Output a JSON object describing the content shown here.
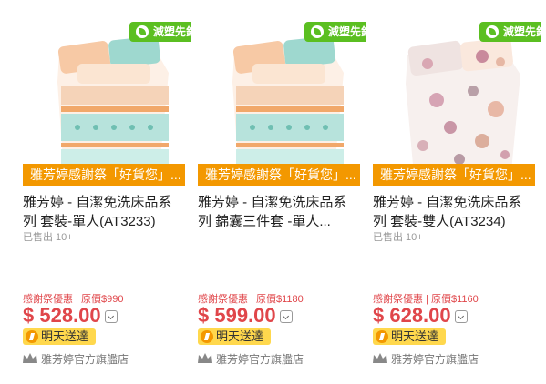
{
  "products": [
    {
      "eco_badge": "減塑先鋒",
      "promo": "雅芳婷感謝祭「好貨您」...",
      "title": "雅芳婷 - 自潔免洗床品系列 套裝-單人(AT3233)",
      "sold": "已售出 10+",
      "price_note": "感謝祭優惠 | 原價$990",
      "price": "$ 528.00",
      "delivery": "明天送達",
      "store": "雅芳婷官方旗艦店"
    },
    {
      "eco_badge": "減塑先鋒",
      "promo": "雅芳婷感謝祭「好貨您」...",
      "title": "雅芳婷 - 自潔免洗床品系列 錦囊三件套 -單人...",
      "sold": "",
      "price_note": "感謝祭優惠 | 原價$1180",
      "price": "$ 599.00",
      "delivery": "明天送達",
      "store": "雅芳婷官方旗艦店"
    },
    {
      "eco_badge": "減塑先鋒",
      "promo": "雅芳婷感謝祭「好貨您」...",
      "title": "雅芳婷 - 自潔免洗床品系列 套裝-雙人(AT3234)",
      "sold": "已售出 10+",
      "price_note": "感謝祭優惠 | 原價$1160",
      "price": "$ 628.00",
      "delivery": "明天送達",
      "store": "雅芳婷官方旗艦店"
    }
  ],
  "colors": {
    "eco_green": "#5bbf21",
    "promo_orange": "#f39800",
    "price_red": "#e0464a",
    "delivery_yellow": "#ffd84d"
  }
}
